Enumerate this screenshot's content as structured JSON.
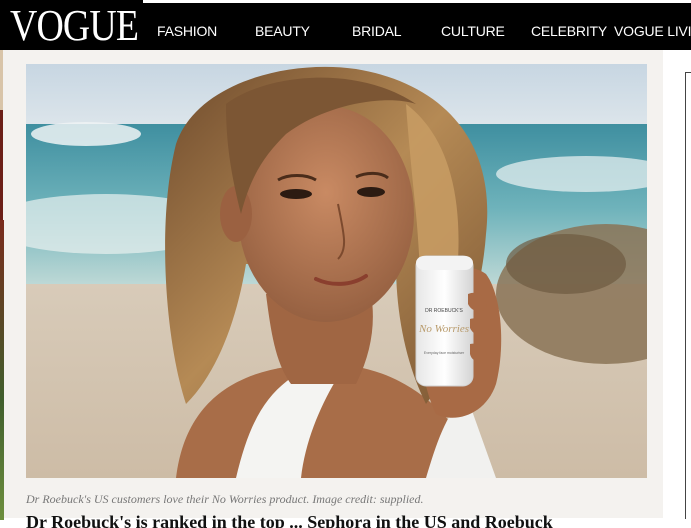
{
  "brand": {
    "logo_text": "VOGUE"
  },
  "nav": {
    "items": [
      "FASHION",
      "BEAUTY",
      "BRIDAL",
      "CULTURE",
      "CELEBRITY",
      "VOGUE LIVIN"
    ]
  },
  "article": {
    "image": {
      "product_brand": "DR ROEBUCK'S",
      "product_name": "No Worries",
      "product_subtext": "Everyday face moisturiser"
    },
    "caption": "Dr Roebuck's US customers love their No Worries product. Image credit: supplied.",
    "headline_partial": "Dr Roebuck's is ranked in the top ... Sephora in the US and Roebuck"
  },
  "colors": {
    "nav_bg": "#000000",
    "nav_text": "#ffffff",
    "page_bg": "#f4f2ef",
    "caption": "#777777"
  }
}
